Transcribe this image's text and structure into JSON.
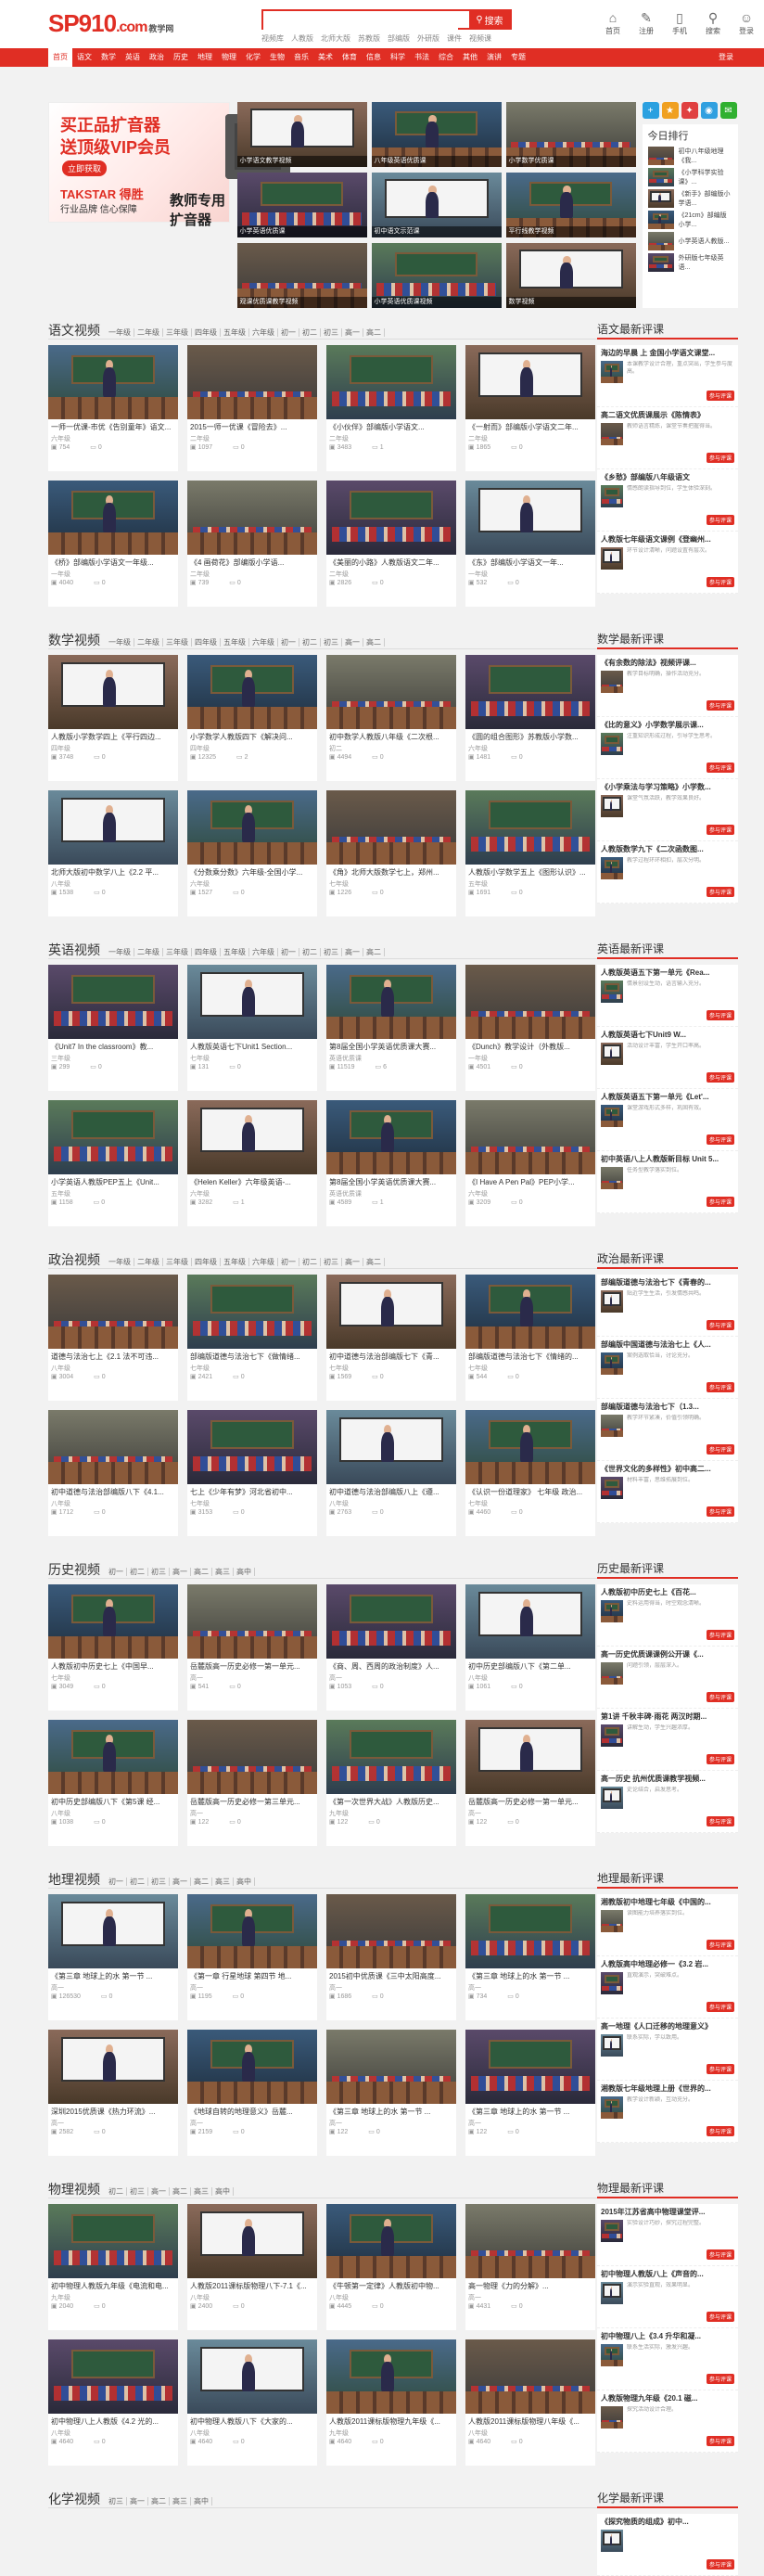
{
  "header": {
    "logo_text": "SP910",
    "logo_suffix": ".com",
    "logo_sub": "教学网",
    "search_placeholder": "",
    "search_button": "搜索",
    "hot_words": [
      "视频库",
      "人教版",
      "北师大版",
      "苏教版",
      "部编版",
      "外研版",
      "课件",
      "视频课"
    ],
    "icons": [
      {
        "label": "首页",
        "icon": "home-icon"
      },
      {
        "label": "注册",
        "icon": "register-icon"
      },
      {
        "label": "手机",
        "icon": "phone-icon"
      },
      {
        "label": "搜索",
        "icon": "search-icon"
      },
      {
        "label": "登录",
        "icon": "user-icon"
      }
    ]
  },
  "nav": {
    "items": [
      "首页",
      "语文",
      "数学",
      "英语",
      "政治",
      "历史",
      "地理",
      "物理",
      "化学",
      "生物",
      "音乐",
      "美术",
      "体育",
      "信息",
      "科学",
      "书法",
      "综合",
      "其他",
      "演讲",
      "专题"
    ],
    "login": "登录"
  },
  "banner": {
    "line1": "买正品扩音器",
    "line2": "送顶级VIP会员",
    "btn": "立即获取",
    "brand": "TAKSTAR 得胜",
    "slogan": "行业品牌 信心保障",
    "tagline": "教师专用扩音器"
  },
  "hero_captions": [
    "小学语文教学视频",
    "八年级英语优质课",
    "小学数学优质课",
    "小学英语优质课",
    "初中语文示范课",
    "平行线教学视频",
    "观课优质课教学视频",
    "小学英语优质课视频",
    "数学视频"
  ],
  "ranking": {
    "title": "今日排行",
    "items": [
      "初中八年级地理《我...",
      "《小学科学实验课》...",
      "《新手》部编版小学语...",
      "《21cm》部编版小学...",
      "小学英语人教版...",
      "外研版七年级英语..."
    ]
  },
  "share_icons": [
    "plus-icon",
    "qzone-icon",
    "weibo-icon",
    "qq-icon",
    "wechat-icon"
  ],
  "sections": [
    {
      "title": "语文视频",
      "tags": [
        "一年级",
        "二年级",
        "三年级",
        "四年级",
        "五年级",
        "六年级",
        "初一",
        "初二",
        "初三",
        "高一",
        "高二"
      ],
      "review_title": "语文最新评课",
      "videos": [
        {
          "title": "一师一优课-市优《告别童年》语文...",
          "grade": "六年级",
          "views": "754",
          "likes": "0"
        },
        {
          "title": "2015一师一优课《冒险去》...",
          "grade": "二年级",
          "views": "1097",
          "likes": "0"
        },
        {
          "title": "《小伙伴》部编版小学语文...",
          "grade": "二年级",
          "views": "3483",
          "likes": "1"
        },
        {
          "title": "《一射而》部编版小学语文二年...",
          "grade": "二年级",
          "views": "1865",
          "likes": "0"
        },
        {
          "title": "《桥》部编版小学语文一年级...",
          "grade": "一年级",
          "views": "4040",
          "likes": "0"
        },
        {
          "title": "《4 画荷花》部编版小学语...",
          "grade": "二年级",
          "views": "739",
          "likes": "0"
        },
        {
          "title": "《美丽的小路》人教版语文二年...",
          "grade": "二年级",
          "views": "2826",
          "likes": "0"
        },
        {
          "title": "《东》部编版小学语文一年...",
          "grade": "一年级",
          "views": "532",
          "likes": "0"
        }
      ],
      "reviews": [
        {
          "title": "海边的早晨 上 金国小学语文课堂...",
          "text": "本课教学设计合理，重点突出，学生参与度高。"
        },
        {
          "title": "高二语文优质课展示《陈情表》",
          "text": "教师语言精炼，课堂节奏把握得当。"
        },
        {
          "title": "《乡愁》部编版八年级语文",
          "text": "情感朗读指导到位，学生体验深刻。"
        },
        {
          "title": "人教版七年级语文课例《登幽州...",
          "text": "环节设计清晰，问题设置有层次。"
        }
      ]
    },
    {
      "title": "数学视频",
      "tags": [
        "一年级",
        "二年级",
        "三年级",
        "四年级",
        "五年级",
        "六年级",
        "初一",
        "初二",
        "初三",
        "高一",
        "高二"
      ],
      "review_title": "数学最新评课",
      "videos": [
        {
          "title": "人教版小学数学四上《平行四边...",
          "grade": "四年级",
          "views": "3748",
          "likes": "0"
        },
        {
          "title": "小学数学人教版四下《解决问...",
          "grade": "四年级",
          "views": "12325",
          "likes": "2"
        },
        {
          "title": "初中数学人教版八年级《二次根...",
          "grade": "初二",
          "views": "4494",
          "likes": "0"
        },
        {
          "title": "《圆的组合图形》苏教版小学数...",
          "grade": "六年级",
          "views": "1481",
          "likes": "0"
        },
        {
          "title": "北师大版初中数学八上《2.2 平...",
          "grade": "八年级",
          "views": "1538",
          "likes": "0"
        },
        {
          "title": "《分数乘分数》六年级-全国小学...",
          "grade": "六年级",
          "views": "1527",
          "likes": "0"
        },
        {
          "title": "《角》北师大版数学七上，郑州...",
          "grade": "七年级",
          "views": "1226",
          "likes": "0"
        },
        {
          "title": "人教版小学数学五上《图形认识》...",
          "grade": "五年级",
          "views": "1691",
          "likes": "0"
        }
      ],
      "reviews": [
        {
          "title": "《有余数的除法》视频评课...",
          "text": "教学目标明确，操作活动充分。"
        },
        {
          "title": "《比的意义》小学数学展示课...",
          "text": "注重知识形成过程，引导学生思考。"
        },
        {
          "title": "《小学乘法与学习策略》小学数...",
          "text": "课堂气氛活跃，教学效果良好。"
        },
        {
          "title": "人教版数学九下《二次函数图...",
          "text": "教学过程环环相扣，层次分明。"
        }
      ]
    },
    {
      "title": "英语视频",
      "tags": [
        "一年级",
        "二年级",
        "三年级",
        "四年级",
        "五年级",
        "六年级",
        "初一",
        "初二",
        "初三",
        "高一",
        "高二"
      ],
      "review_title": "英语最新评课",
      "videos": [
        {
          "title": "《Unit7 In the classroom》教...",
          "grade": "三年级",
          "views": "299",
          "likes": "0"
        },
        {
          "title": "人教版英语七下Unit1 Section...",
          "grade": "七年级",
          "views": "131",
          "likes": "0"
        },
        {
          "title": "第8届全国小学英语优质课大赛...",
          "grade": "英语优质课",
          "views": "11519",
          "likes": "6"
        },
        {
          "title": "《Dunch》教学设计（外教版...",
          "grade": "一年级",
          "views": "4501",
          "likes": "0"
        },
        {
          "title": "小学英语人教版PEP五上《Unit...",
          "grade": "五年级",
          "views": "1158",
          "likes": "0"
        },
        {
          "title": "《Helen Keller》六年级英语-...",
          "grade": "六年级",
          "views": "3282",
          "likes": "1"
        },
        {
          "title": "第8届全国小学英语优质课大赛...",
          "grade": "英语优质课",
          "views": "4589",
          "likes": "1"
        },
        {
          "title": "《I Have A Pen Pal》PEP小学...",
          "grade": "六年级",
          "views": "3209",
          "likes": "0"
        }
      ],
      "reviews": [
        {
          "title": "人教版英语五下第一单元《Rea...",
          "text": "情景创设生动，语言输入充分。"
        },
        {
          "title": "人教版英语七下Unit9 W...",
          "text": "活动设计丰富，学生开口率高。"
        },
        {
          "title": "人教版英语五下第一单元《Let'...",
          "text": "课堂游戏形式多样，巩固有效。"
        },
        {
          "title": "初中英语八上人教版新目标 Unit 5...",
          "text": "任务型教学落实到位。"
        }
      ]
    },
    {
      "title": "政治视频",
      "tags": [
        "一年级",
        "二年级",
        "三年级",
        "四年级",
        "五年级",
        "六年级",
        "初一",
        "初二",
        "初三",
        "高一",
        "高二"
      ],
      "review_title": "政治最新评课",
      "videos": [
        {
          "title": "道德与法治七上《2.1 法不可违...",
          "grade": "八年级",
          "views": "3004",
          "likes": "0"
        },
        {
          "title": "部编版道德与法治七下《做情绪...",
          "grade": "七年级",
          "views": "2421",
          "likes": "0"
        },
        {
          "title": "初中道德与法治部编版七下《青...",
          "grade": "七年级",
          "views": "1569",
          "likes": "0"
        },
        {
          "title": "部编版道德与法治七下《情绪的...",
          "grade": "七年级",
          "views": "544",
          "likes": "0"
        },
        {
          "title": "初中道德与法治部编版八下《4.1...",
          "grade": "八年级",
          "views": "1712",
          "likes": "0"
        },
        {
          "title": "七上《少年有梦》河北省初中...",
          "grade": "七年级",
          "views": "3153",
          "likes": "0"
        },
        {
          "title": "初中道德与法治部编版八上《遵...",
          "grade": "八年级",
          "views": "2763",
          "likes": "0"
        },
        {
          "title": "《认识一份道理家》 七年级 政治...",
          "grade": "七年级",
          "views": "4460",
          "likes": "0"
        }
      ],
      "reviews": [
        {
          "title": "部编版道德与法治七下《青春的...",
          "text": "贴近学生生活，引发情感共鸣。"
        },
        {
          "title": "部编版中国道德与法治七上《人...",
          "text": "案例选取恰当，讨论充分。"
        },
        {
          "title": "部编版道德与法治七下（1.3...",
          "text": "教学环节紧凑，价值引领明确。"
        },
        {
          "title": "《世界文化的多样性》初中高二...",
          "text": "材料丰富，思维拓展到位。"
        }
      ]
    },
    {
      "title": "历史视频",
      "tags": [
        "初一",
        "初二",
        "初三",
        "高一",
        "高二",
        "高三",
        "高中"
      ],
      "review_title": "历史最新评课",
      "videos": [
        {
          "title": "人教版初中历史七上《中国早...",
          "grade": "七年级",
          "views": "3049",
          "likes": "0"
        },
        {
          "title": "岳麓版高一历史必修一第一单元...",
          "grade": "高一",
          "views": "541",
          "likes": "0"
        },
        {
          "title": "《商、周、西周的政治制度》人...",
          "grade": "高一",
          "views": "1053",
          "likes": "0"
        },
        {
          "title": "初中历史部编版八下《第二单...",
          "grade": "八年级",
          "views": "1061",
          "likes": "0"
        },
        {
          "title": "初中历史部编版八下《第5课 经...",
          "grade": "八年级",
          "views": "1038",
          "likes": "0"
        },
        {
          "title": "岳麓版高一历史必修一第三单元...",
          "grade": "高一",
          "views": "122",
          "likes": "0"
        },
        {
          "title": "《第一次世界大战》人教版历史...",
          "grade": "九年级",
          "views": "122",
          "likes": "0"
        },
        {
          "title": "岳麓版高一历史必修一第一单元...",
          "grade": "高一",
          "views": "122",
          "likes": "0"
        }
      ],
      "reviews": [
        {
          "title": "人教版初中历史七上《百花...",
          "text": "史料运用得当，时空观念清晰。"
        },
        {
          "title": "高一历史优质课课例公开课《...",
          "text": "问题引领，层层深入。"
        },
        {
          "title": "第1讲 千秋丰碑·雨花 两汉时期...",
          "text": "讲解生动，学生兴趣浓厚。"
        },
        {
          "title": "高一历史 抗州优质课教学视频...",
          "text": "史论结合，启发思考。"
        }
      ]
    },
    {
      "title": "地理视频",
      "tags": [
        "初一",
        "初二",
        "初三",
        "高一",
        "高二",
        "高三",
        "高中"
      ],
      "review_title": "地理最新评课",
      "videos": [
        {
          "title": "《第三章 地球上的水 第一节 ...",
          "grade": "高一",
          "views": "126530",
          "likes": "0"
        },
        {
          "title": "《第一章 行星地球 第四节 地...",
          "grade": "高一",
          "views": "1195",
          "likes": "0"
        },
        {
          "title": "2015初中优质课《三中太阳高度...",
          "grade": "高一",
          "views": "1686",
          "likes": "0"
        },
        {
          "title": "《第三章 地球上的水 第一节 ...",
          "grade": "高一",
          "views": "734",
          "likes": "0"
        },
        {
          "title": "深圳2015优质课《热力环流》...",
          "grade": "高一",
          "views": "2582",
          "likes": "0"
        },
        {
          "title": "《地球自转的地理意义》岳麓...",
          "grade": "高一",
          "views": "2159",
          "likes": "0"
        },
        {
          "title": "《第三章 地球上的水 第一节 ...",
          "grade": "高一",
          "views": "122",
          "likes": "0"
        },
        {
          "title": "《第三章 地球上的水 第一节 ...",
          "grade": "高一",
          "views": "122",
          "likes": "0"
        }
      ],
      "reviews": [
        {
          "title": "湘教版初中地理七年级《中国的...",
          "text": "读图能力培养落实到位。"
        },
        {
          "title": "人教版高中地理必修一《3.2 岩...",
          "text": "直观演示，突破难点。"
        },
        {
          "title": "高一地理《人口迁移的地理意义》",
          "text": "联系实际，学以致用。"
        },
        {
          "title": "湘教版七年级地理上册《世界的...",
          "text": "教学设计新颖，互动充分。"
        }
      ]
    },
    {
      "title": "物理视频",
      "tags": [
        "初二",
        "初三",
        "高一",
        "高二",
        "高三",
        "高中"
      ],
      "review_title": "物理最新评课",
      "videos": [
        {
          "title": "初中物理人教版九年级《电流和电...",
          "grade": "九年级",
          "views": "2040",
          "likes": "0"
        },
        {
          "title": "人教版2011课标版物理八下-7.1《...",
          "grade": "八年级",
          "views": "2400",
          "likes": "0"
        },
        {
          "title": "《牛顿第一定律》人教版初中物...",
          "grade": "八年级",
          "views": "4445",
          "likes": "0"
        },
        {
          "title": "高一物理《力的分解》...",
          "grade": "高一",
          "views": "4431",
          "likes": "0"
        },
        {
          "title": "初中物理八上人教版《4.2 光的...",
          "grade": "八年级",
          "views": "4640",
          "likes": "0"
        },
        {
          "title": "初中物理人教版八下《大家的...",
          "grade": "八年级",
          "views": "4640",
          "likes": "0"
        },
        {
          "title": "人教版2011课标版物理九年级《...",
          "grade": "九年级",
          "views": "4640",
          "likes": "0"
        },
        {
          "title": "人教版2011课标版物理八年级《...",
          "grade": "八年级",
          "views": "4640",
          "likes": "0"
        }
      ],
      "reviews": [
        {
          "title": "2015年江苏省高中物理课堂评...",
          "text": "实验设计巧妙，探究过程完整。"
        },
        {
          "title": "初中物理人教版八上《声音的...",
          "text": "演示实验直观，效果明显。"
        },
        {
          "title": "初中物理八上《3.4 升华和凝...",
          "text": "联系生活实际，激发兴趣。"
        },
        {
          "title": "人教版物理九年级《20.1 磁...",
          "text": "探究活动设计合理。"
        }
      ]
    },
    {
      "title": "化学视频",
      "tags": [
        "初三",
        "高一",
        "高二",
        "高三",
        "高中"
      ],
      "review_title": "化学最新评课",
      "videos": [],
      "reviews": [
        {
          "title": "《探究物质的组成》初中...",
          "text": ""
        }
      ]
    }
  ]
}
